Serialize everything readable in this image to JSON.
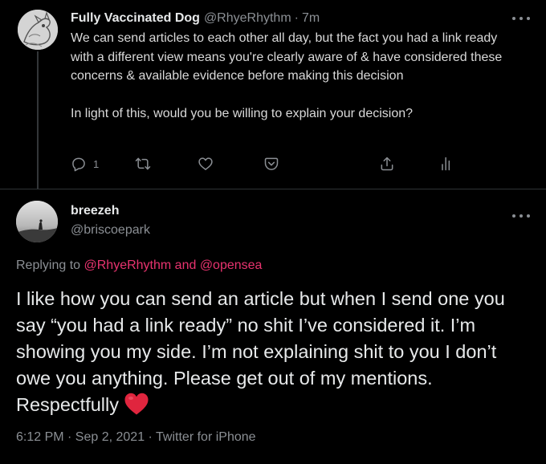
{
  "tweet1": {
    "author_name": "Fully Vaccinated Dog",
    "author_handle": "@RhyeRhythm",
    "separator": "·",
    "time": "7m",
    "paragraph1": "We can send articles to each other all day, but the fact you had a link ready with a different view means you're clearly aware of & have considered these concerns & available evidence before making this decision",
    "paragraph2": "In light of this, would you be willing to explain your decision?",
    "reply_count": "1",
    "icons": [
      "reply-icon",
      "retweet-icon",
      "like-icon",
      "tip-icon",
      "share-icon",
      "analytics-icon"
    ]
  },
  "tweet2": {
    "author_name": "breezeh",
    "author_handle": "@briscoepark",
    "replying_prefix": "Replying to ",
    "replying_user1": "@RhyeRhythm",
    "replying_and": " and ",
    "replying_user2": "@opensea",
    "body": "I like how you can send an article but when I send one you say “you had a link ready” no shit I’ve considered it. I’m showing you my side. I’m not explaining shit to you I don’t owe you anything. Please get out of my mentions. Respectfully",
    "emoji": "red-heart",
    "timestamp": "6:12 PM · Sep 2, 2021 · Twitter for iPhone"
  },
  "colors": {
    "background": "#000000",
    "text": "#e7e9ea",
    "muted": "#8b8f94",
    "mention": "#e8336f",
    "heart": "#e0253e",
    "divider": "#2f3336"
  }
}
